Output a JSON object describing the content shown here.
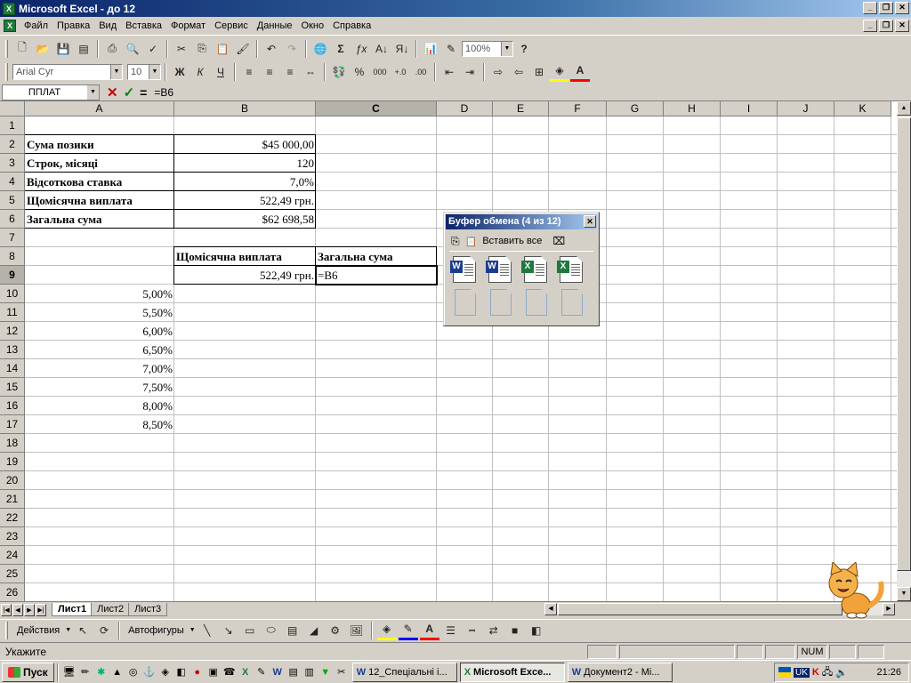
{
  "window": {
    "title": "Microsoft Excel - до 12"
  },
  "menu": [
    "Файл",
    "Правка",
    "Вид",
    "Вставка",
    "Формат",
    "Сервис",
    "Данные",
    "Окно",
    "Справка"
  ],
  "toolbar": {
    "zoom": "100%",
    "font": "Arial Cyr",
    "size": "10",
    "bold": "Ж",
    "italic": "К",
    "underline": "Ч",
    "percent": "%",
    "thousands": "000"
  },
  "formula": {
    "namebox": "ППЛАТ",
    "eq": "=",
    "content": "=B6"
  },
  "columns": [
    "A",
    "B",
    "C",
    "D",
    "E",
    "F",
    "G",
    "H",
    "I",
    "J",
    "K"
  ],
  "rows": [
    "1",
    "2",
    "3",
    "4",
    "5",
    "6",
    "7",
    "8",
    "9",
    "10",
    "11",
    "12",
    "13",
    "14",
    "15",
    "16",
    "17",
    "18",
    "19",
    "20",
    "21",
    "22",
    "23",
    "24",
    "25",
    "26"
  ],
  "cells": {
    "A2": "Сума позики",
    "B2": "$45 000,00",
    "A3": "Строк, місяці",
    "B3": "120",
    "A4": "Відсоткова ставка",
    "B4": "7,0%",
    "A5": "Щомісячна виплата",
    "B5": "522,49 грн.",
    "A6": "Загальна сума",
    "B6": "$62 698,58",
    "B8": "Щомісячна виплата",
    "C8": "Загальна сума",
    "B9": "522,49 грн.",
    "C9": "=B6",
    "A10": "5,00%",
    "A11": "5,50%",
    "A12": "6,00%",
    "A13": "6,50%",
    "A14": "7,00%",
    "A15": "7,50%",
    "A16": "8,00%",
    "A17": "8,50%"
  },
  "sheets": [
    "Лист1",
    "Лист2",
    "Лист3"
  ],
  "drawing": {
    "actions": "Действия",
    "autoshapes": "Автофигуры"
  },
  "status": {
    "text": "Укажите",
    "num": "NUM"
  },
  "clipboard": {
    "title": "Буфер обмена (4 из 12)",
    "paste_all": "Вставить все",
    "items": [
      "word",
      "word",
      "excel",
      "excel"
    ]
  },
  "taskbar": {
    "start": "Пуск",
    "tasks": [
      "12_Спеціальні і...",
      "Microsoft Exce...",
      "Документ2 - Mi..."
    ],
    "lang": "UK",
    "clock": "21:26"
  }
}
